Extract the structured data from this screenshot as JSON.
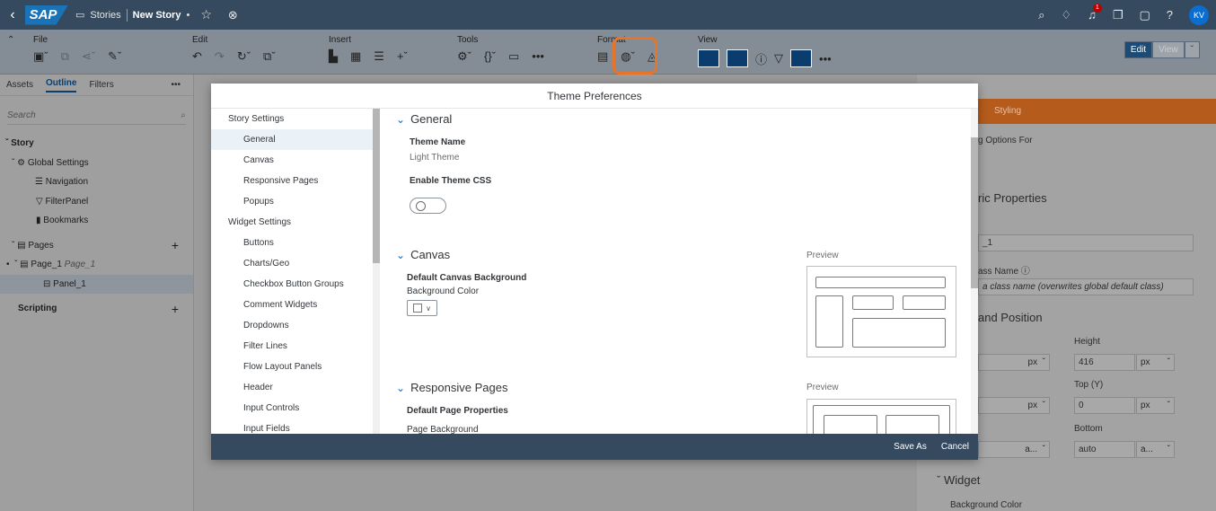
{
  "shell": {
    "logo": "SAP",
    "stories": "Stories",
    "story_name": "New Story",
    "story_modified": "•",
    "notif_count": "1",
    "avatar": "KV"
  },
  "toolbar": {
    "groups": [
      {
        "label": "File"
      },
      {
        "label": "Edit"
      },
      {
        "label": "Insert"
      },
      {
        "label": "Tools"
      },
      {
        "label": "Format"
      },
      {
        "label": "View"
      }
    ],
    "edit_mode": "Edit",
    "view_mode": "View"
  },
  "left_panel": {
    "tabs": [
      "Assets",
      "Outline",
      "Filters"
    ],
    "more": "•••",
    "search_placeholder": "Search",
    "tree": {
      "story": "Story",
      "global_settings": "Global Settings",
      "navigation": "Navigation",
      "filterpanel": "FilterPanel",
      "bookmarks": "Bookmarks",
      "pages": "Pages",
      "page1": "Page_1",
      "page1_alias": "Page_1",
      "panel1": "Panel_1",
      "scripting": "Scripting"
    }
  },
  "right_panel": {
    "tab": "Styling",
    "options_for": "g Options For",
    "generic_props": "ric Properties",
    "name_value": "_1",
    "css_class_label": "ass Name",
    "css_placeholder": "a class name (overwrites global default class)",
    "size_pos": "and Position",
    "height_label": "Height",
    "height_value": "416",
    "unit": "px",
    "top_label": "Top (Y)",
    "top_value": "0",
    "bottom_label": "Bottom",
    "bottom_value": "auto",
    "auto_short": "a...",
    "widget": "Widget",
    "bg_color": "Background Color"
  },
  "dialog": {
    "title": "Theme Preferences",
    "nav": [
      {
        "label": "Story Settings",
        "type": "cat"
      },
      {
        "label": "General",
        "type": "sub",
        "active": true
      },
      {
        "label": "Canvas",
        "type": "sub"
      },
      {
        "label": "Responsive Pages",
        "type": "sub"
      },
      {
        "label": "Popups",
        "type": "sub"
      },
      {
        "label": "Widget Settings",
        "type": "cat"
      },
      {
        "label": "Buttons",
        "type": "sub"
      },
      {
        "label": "Charts/Geo",
        "type": "sub"
      },
      {
        "label": "Checkbox Button Groups",
        "type": "sub"
      },
      {
        "label": "Comment Widgets",
        "type": "sub"
      },
      {
        "label": "Dropdowns",
        "type": "sub"
      },
      {
        "label": "Filter Lines",
        "type": "sub"
      },
      {
        "label": "Flow Layout Panels",
        "type": "sub"
      },
      {
        "label": "Header",
        "type": "sub"
      },
      {
        "label": "Input Controls",
        "type": "sub"
      },
      {
        "label": "Input Fields",
        "type": "sub"
      }
    ],
    "general": {
      "heading": "General",
      "theme_name_label": "Theme Name",
      "theme_name_value": "Light Theme",
      "enable_css_label": "Enable Theme CSS",
      "enable_css_on": false
    },
    "canvas": {
      "heading": "Canvas",
      "bg_label": "Default Canvas Background",
      "bg_sublabel": "Background Color",
      "preview": "Preview"
    },
    "responsive": {
      "heading": "Responsive Pages",
      "props_label": "Default Page Properties",
      "bg_sublabel": "Page Background",
      "preview": "Preview"
    },
    "save_as": "Save As",
    "cancel": "Cancel"
  }
}
